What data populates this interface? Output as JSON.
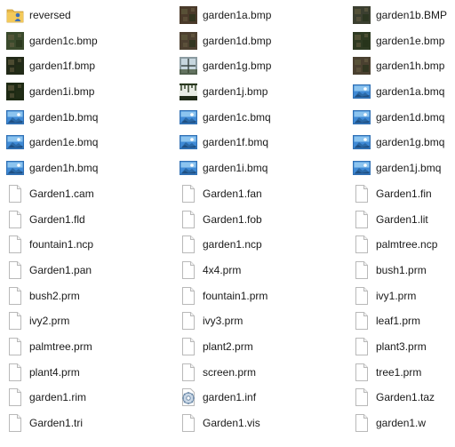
{
  "colors": {
    "background": "#ffffff",
    "text": "#1a1a1a",
    "folder": "#e8b84a",
    "doc_border": "#b9b9b9",
    "bmq_sky": "#4a90d9"
  },
  "files": [
    {
      "name": "reversed",
      "icon": "folder-user-icon"
    },
    {
      "name": "garden1a.bmp",
      "icon": "bmp-thumb-icon",
      "thumb": "#4a3a2a"
    },
    {
      "name": "garden1b.BMP",
      "icon": "bmp-thumb-icon",
      "thumb": "#3b3f30"
    },
    {
      "name": "garden1c.bmp",
      "icon": "bmp-thumb-icon",
      "thumb": "#3a4a2c"
    },
    {
      "name": "garden1d.bmp",
      "icon": "bmp-thumb-icon",
      "thumb": "#4d4030"
    },
    {
      "name": "garden1e.bmp",
      "icon": "bmp-thumb-icon",
      "thumb": "#2e3a22"
    },
    {
      "name": "garden1f.bmp",
      "icon": "bmp-thumb-icon",
      "thumb": "#222a18"
    },
    {
      "name": "garden1g.bmp",
      "icon": "bmp-window-thumb-icon",
      "thumb": "#8a9aa0"
    },
    {
      "name": "garden1h.bmp",
      "icon": "bmp-thumb-icon",
      "thumb": "#4a4030"
    },
    {
      "name": "garden1i.bmp",
      "icon": "bmp-thumb-icon",
      "thumb": "#1e2a14"
    },
    {
      "name": "garden1j.bmp",
      "icon": "bmp-vine-thumb-icon",
      "thumb": "#e8ece4"
    },
    {
      "name": "garden1a.bmq",
      "icon": "bmq-image-icon"
    },
    {
      "name": "garden1b.bmq",
      "icon": "bmq-image-icon"
    },
    {
      "name": "garden1c.bmq",
      "icon": "bmq-image-icon"
    },
    {
      "name": "garden1d.bmq",
      "icon": "bmq-image-icon"
    },
    {
      "name": "garden1e.bmq",
      "icon": "bmq-image-icon"
    },
    {
      "name": "garden1f.bmq",
      "icon": "bmq-image-icon"
    },
    {
      "name": "garden1g.bmq",
      "icon": "bmq-image-icon"
    },
    {
      "name": "garden1h.bmq",
      "icon": "bmq-image-icon"
    },
    {
      "name": "garden1i.bmq",
      "icon": "bmq-image-icon"
    },
    {
      "name": "garden1j.bmq",
      "icon": "bmq-image-icon"
    },
    {
      "name": "Garden1.cam",
      "icon": "blank-file-icon"
    },
    {
      "name": "Garden1.fan",
      "icon": "blank-file-icon"
    },
    {
      "name": "Garden1.fin",
      "icon": "blank-file-icon"
    },
    {
      "name": "Garden1.fld",
      "icon": "blank-file-icon"
    },
    {
      "name": "Garden1.fob",
      "icon": "blank-file-icon"
    },
    {
      "name": "Garden1.lit",
      "icon": "blank-file-icon"
    },
    {
      "name": "fountain1.ncp",
      "icon": "blank-file-icon"
    },
    {
      "name": "garden1.ncp",
      "icon": "blank-file-icon"
    },
    {
      "name": "palmtree.ncp",
      "icon": "blank-file-icon"
    },
    {
      "name": "Garden1.pan",
      "icon": "blank-file-icon"
    },
    {
      "name": "4x4.prm",
      "icon": "blank-file-icon"
    },
    {
      "name": "bush1.prm",
      "icon": "blank-file-icon"
    },
    {
      "name": "bush2.prm",
      "icon": "blank-file-icon"
    },
    {
      "name": "fountain1.prm",
      "icon": "blank-file-icon"
    },
    {
      "name": "ivy1.prm",
      "icon": "blank-file-icon"
    },
    {
      "name": "ivy2.prm",
      "icon": "blank-file-icon"
    },
    {
      "name": "ivy3.prm",
      "icon": "blank-file-icon"
    },
    {
      "name": "leaf1.prm",
      "icon": "blank-file-icon"
    },
    {
      "name": "palmtree.prm",
      "icon": "blank-file-icon"
    },
    {
      "name": "plant2.prm",
      "icon": "blank-file-icon"
    },
    {
      "name": "plant3.prm",
      "icon": "blank-file-icon"
    },
    {
      "name": "plant4.prm",
      "icon": "blank-file-icon"
    },
    {
      "name": "screen.prm",
      "icon": "blank-file-icon"
    },
    {
      "name": "tree1.prm",
      "icon": "blank-file-icon"
    },
    {
      "name": "garden1.rim",
      "icon": "blank-file-icon"
    },
    {
      "name": "garden1.inf",
      "icon": "settings-file-icon"
    },
    {
      "name": "Garden1.taz",
      "icon": "blank-file-icon"
    },
    {
      "name": "Garden1.tri",
      "icon": "blank-file-icon"
    },
    {
      "name": "Garden1.vis",
      "icon": "blank-file-icon"
    },
    {
      "name": "garden1.w",
      "icon": "blank-file-icon"
    }
  ]
}
